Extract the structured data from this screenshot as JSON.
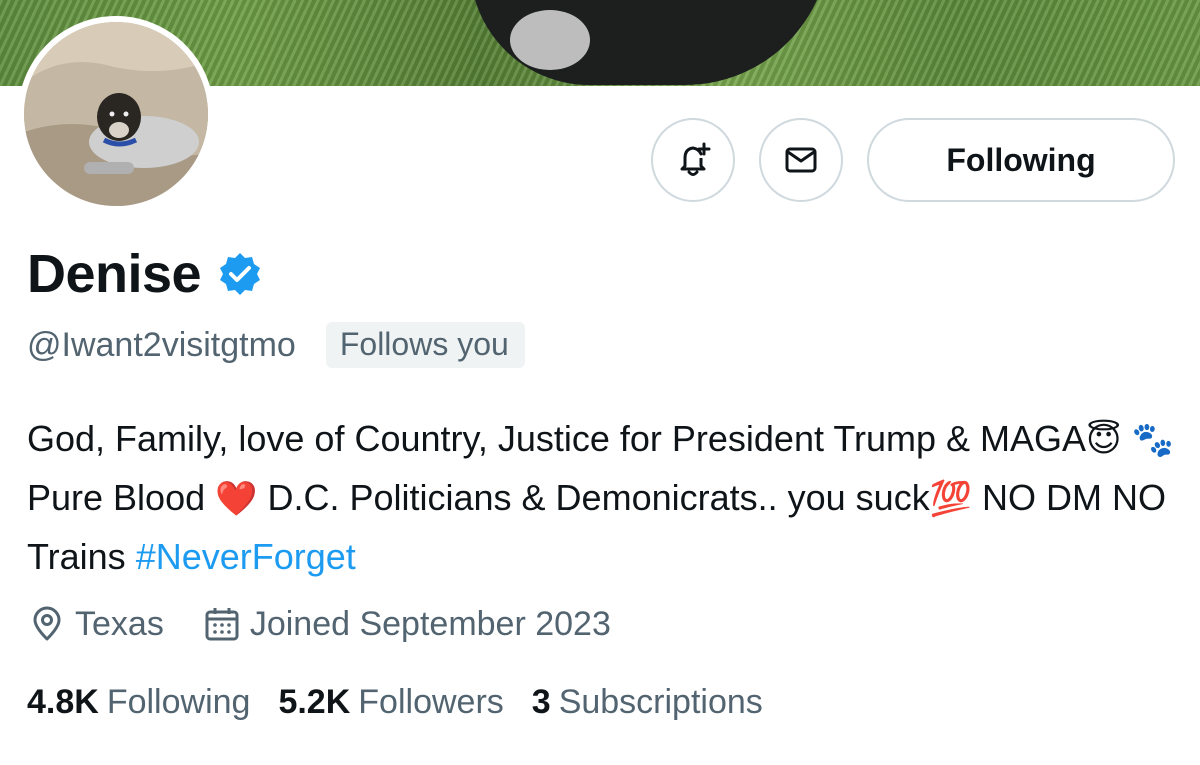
{
  "profile": {
    "display_name": "Denise",
    "handle": "@Iwant2visitgtmo",
    "follows_you_label": "Follows you",
    "follow_button_label": "Following",
    "bio": {
      "part1": "God, Family, love of Country, Justice for President Trump & MAGA",
      "emoji_angel": "😇",
      "emoji_paws": "🐾",
      "part2": "Pure Blood ",
      "emoji_heart": "❤️",
      "part3": " D.C. Politicians & Demonicrats.. you suck",
      "emoji_100": "💯",
      "part4": " NO DM NO Trains ",
      "hashtag": "#NeverForget"
    },
    "location": "Texas",
    "joined": "Joined September 2023",
    "stats": {
      "following_count": "4.8K",
      "following_label": "Following",
      "followers_count": "5.2K",
      "followers_label": "Followers",
      "subscriptions_count": "3",
      "subscriptions_label": "Subscriptions"
    }
  },
  "colors": {
    "accent": "#1d9bf0",
    "secondary_text": "#536471",
    "border": "#cfd9de",
    "badge_bg": "#eff3f4"
  },
  "icons": {
    "notify": "bell-plus-icon",
    "message": "envelope-icon",
    "verified": "verified-badge-icon",
    "location": "location-pin-icon",
    "calendar": "calendar-icon"
  }
}
